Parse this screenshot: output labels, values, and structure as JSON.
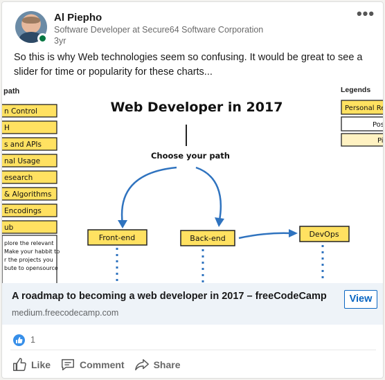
{
  "post": {
    "author_name": "Al Piepho",
    "author_title": "Software Developer at Secure64 Software Corporation",
    "time": "3yr",
    "more_label": "•••",
    "text": "So this is why Web technologies seem so confusing. It would be great to see a slider for time or popularity for these charts..."
  },
  "preview_image": {
    "title": "Web Developer in 2017",
    "choose": "Choose your path",
    "left_col_header": "path",
    "left_items": [
      "n Control",
      "H",
      "s and APIs",
      "nal Usage",
      "esearch",
      "& Algorithms",
      "Encodings",
      "ub"
    ],
    "left_note": [
      "plore the relevant",
      "Make your habbit to",
      "r the projects you",
      "bute to opensource"
    ],
    "legends_header": "Legends",
    "legend_items": [
      "Personal Re",
      "Pos",
      "Pi"
    ],
    "paths": [
      "Front-end",
      "Back-end",
      "DevOps"
    ]
  },
  "link": {
    "title": "A roadmap to becoming a web developer in 2017 – freeCodeCamp",
    "domain": "medium.freecodecamp.com",
    "view_label": "View"
  },
  "social": {
    "reaction_count": "1",
    "like_label": "Like",
    "comment_label": "Comment",
    "share_label": "Share"
  },
  "colors": {
    "accent": "#0a66c2",
    "box_yellow": "#ffe161",
    "online": "#057642"
  }
}
